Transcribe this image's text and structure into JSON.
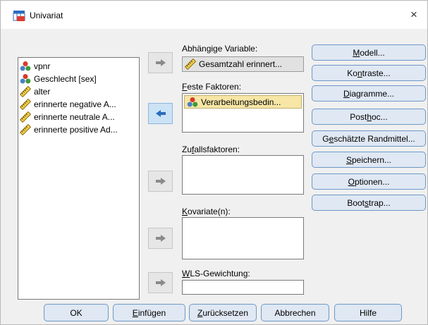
{
  "window": {
    "title": "Univariat",
    "close_glyph": "×"
  },
  "variables": [
    {
      "label": "vpnr",
      "icon": "nominal-icon"
    },
    {
      "label": "Geschlecht [sex]",
      "icon": "nominal-icon"
    },
    {
      "label": "alter",
      "icon": "scale-ruler-icon"
    },
    {
      "label": "erinnerte negative A...",
      "icon": "scale-ruler-icon"
    },
    {
      "label": "erinnerte neutrale A...",
      "icon": "scale-ruler-icon"
    },
    {
      "label": "erinnerte positive Ad...",
      "icon": "scale-ruler-icon"
    }
  ],
  "fields": {
    "dependent": {
      "label_pre": "Abhängige Variable:",
      "value": "Gesamtzahl erinnert..."
    },
    "fixed": {
      "label_u": "F",
      "label_rest": "este Faktoren:",
      "items": [
        "Verarbeitungsbedin..."
      ]
    },
    "random": {
      "label_pre": "Zu",
      "label_u": "f",
      "label_rest": "allsfaktoren:"
    },
    "covariate": {
      "label_u": "K",
      "label_rest": "ovariate(n):"
    },
    "wls": {
      "label_u": "W",
      "label_rest": "LS-Gewichtung:"
    }
  },
  "side_buttons": [
    {
      "pre": "",
      "u": "M",
      "post": "odell..."
    },
    {
      "pre": "Ko",
      "u": "n",
      "post": "traste..."
    },
    {
      "pre": "",
      "u": "D",
      "post": "iagramme..."
    },
    {
      "pre": "Post ",
      "u": "h",
      "post": "oc..."
    },
    {
      "pre": "G",
      "u": "e",
      "post": "schätzte Randmittel..."
    },
    {
      "pre": "",
      "u": "S",
      "post": "peichern..."
    },
    {
      "pre": "",
      "u": "O",
      "post": "ptionen..."
    },
    {
      "pre": "Boot",
      "u": "s",
      "post": "trap..."
    }
  ],
  "bottom_buttons": {
    "ok": "OK",
    "paste_u": "E",
    "paste_rest": "infügen",
    "reset_u": "Z",
    "reset_rest": "urücksetzen",
    "cancel": "Abbrechen",
    "help": "Hilfe"
  }
}
